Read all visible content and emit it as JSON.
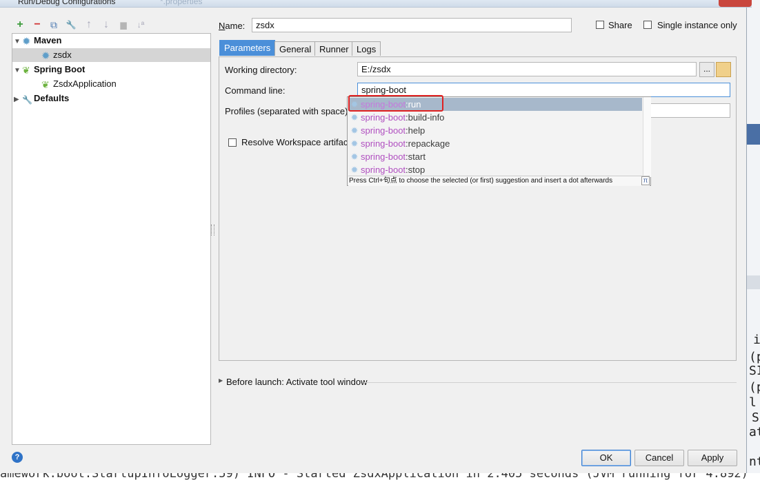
{
  "window": {
    "title": "Run/Debug Configurations",
    "ghost_title": "*.properties"
  },
  "toolbar": {
    "add": "+",
    "remove": "−",
    "copy": "⧉",
    "edit_defaults": "🔧",
    "move_up": "↑",
    "move_down": "↓",
    "folder": "▆",
    "sort": "↓ª"
  },
  "tree": {
    "items": [
      {
        "label": "Maven",
        "bold": true,
        "expanded": true,
        "icon": "gear-icon"
      },
      {
        "label": "zsdx",
        "bold": false,
        "icon": "gear-icon",
        "selected": true
      },
      {
        "label": "Spring Boot",
        "bold": true,
        "expanded": true,
        "icon": "spring-boot-icon"
      },
      {
        "label": "ZsdxApplication",
        "bold": false,
        "icon": "spring-boot-app-icon"
      },
      {
        "label": "Defaults",
        "bold": true,
        "expanded": false,
        "icon": "wrench-icon"
      }
    ]
  },
  "config": {
    "name_label": "Name:",
    "name_value": "zsdx",
    "share_label": "Share",
    "single_instance_label": "Single instance only"
  },
  "tabs": [
    "Parameters",
    "General",
    "Runner",
    "Logs"
  ],
  "parameters": {
    "working_directory_label": "Working directory:",
    "working_directory_value": "E:/zsdx",
    "browse_label": "...",
    "command_line_label": "Command line:",
    "command_line_value": "spring-boot",
    "profiles_label": "Profiles (separated with space)",
    "resolve_workspace_label": "Resolve Workspace artifac"
  },
  "autocomplete": {
    "items": [
      {
        "match": "spring-boot",
        "rest": ":run"
      },
      {
        "match": "spring-boot",
        "rest": ":build-info"
      },
      {
        "match": "spring-boot",
        "rest": ":help"
      },
      {
        "match": "spring-boot",
        "rest": ":repackage"
      },
      {
        "match": "spring-boot",
        "rest": ":start"
      },
      {
        "match": "spring-boot",
        "rest": ":stop"
      }
    ],
    "hint": "Press Ctrl+句点 to choose the selected (or first) suggestion and insert a dot afterwards",
    "pi": "π"
  },
  "before_launch": "Before launch: Activate tool window",
  "buttons": {
    "ok": "OK",
    "cancel": "Cancel",
    "apply": "Apply",
    "help": "?"
  },
  "background": {
    "console_right": [
      "i",
      "(p",
      "SI",
      "(p",
      "l",
      "S",
      "at",
      "nt"
    ],
    "console_bottom": "amework.boot.StartupInfoLogger:59) INFO  - Started ZsdxApplication in 2.405 seconds (JVM running for 4.892)"
  }
}
